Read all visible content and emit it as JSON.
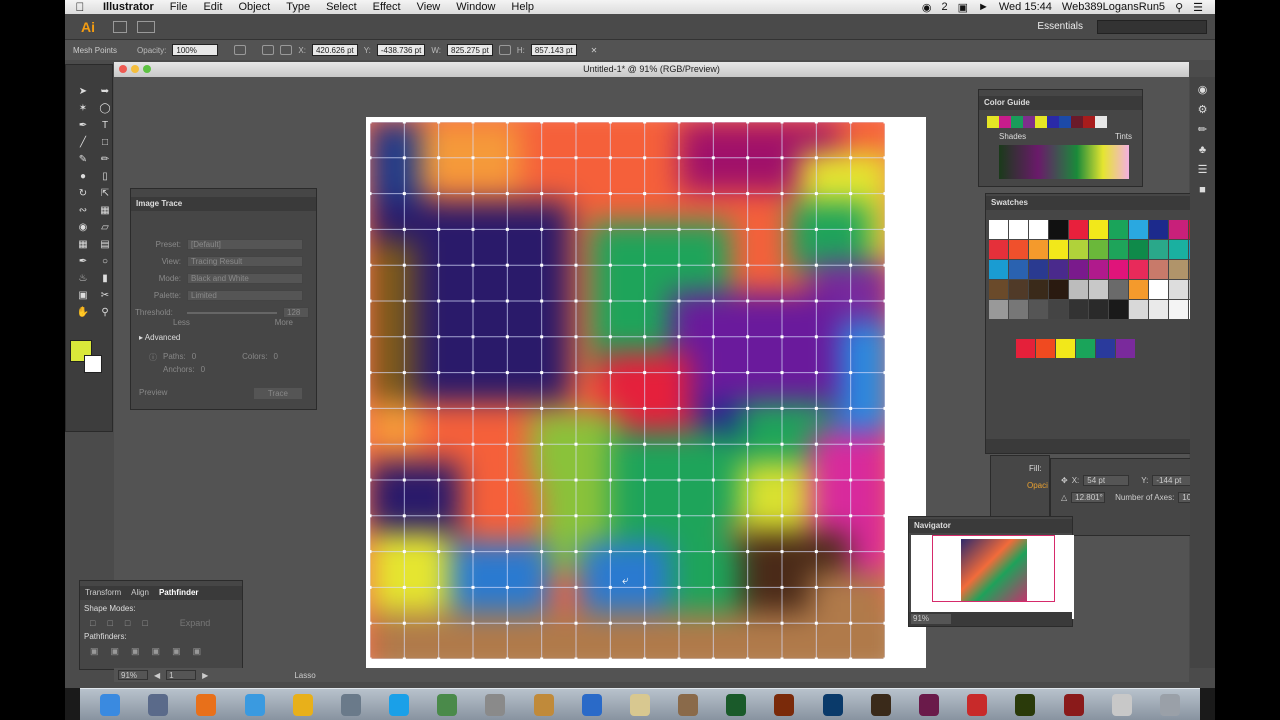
{
  "menubar": {
    "app_name": "Illustrator",
    "items": [
      "File",
      "Edit",
      "Object",
      "Type",
      "Select",
      "Effect",
      "View",
      "Window",
      "Help"
    ],
    "badge": "2",
    "clock": "Wed 15:44",
    "user": "Web389LogansRun5"
  },
  "appbar": {
    "logo": "Ai",
    "workspace": "Essentials"
  },
  "control": {
    "selection": "Mesh Points",
    "opacity_label": "Opacity:",
    "opacity": "100%",
    "x_label": "X:",
    "x": "420.626 pt",
    "y_label": "Y:",
    "y": "-438.736 pt",
    "w_label": "W:",
    "w": "825.275 pt",
    "h_label": "H:",
    "h": "857.143 pt"
  },
  "document": {
    "title": "Untitled-1* @ 91% (RGB/Preview)"
  },
  "image_trace": {
    "title": "Image Trace",
    "preset_label": "Preset:",
    "preset": "[Default]",
    "view_label": "View:",
    "view": "Tracing Result",
    "mode_label": "Mode:",
    "mode": "Black and White",
    "palette_label": "Palette:",
    "palette": "Limited",
    "threshold_label": "Threshold:",
    "threshold": "128",
    "less": "Less",
    "more": "More",
    "advanced": "Advanced",
    "paths_label": "Paths:",
    "paths": "0",
    "colors_label": "Colors:",
    "colors": "0",
    "anchors_label": "Anchors:",
    "anchors": "0",
    "preview": "Preview",
    "trace_button": "Trace"
  },
  "pathfinder": {
    "tabs": [
      "Transform",
      "Align",
      "Pathfinder"
    ],
    "shape_modes": "Shape Modes:",
    "pathfinders": "Pathfinders:",
    "expand": "Expand"
  },
  "color_guide": {
    "title": "Color Guide",
    "shades": "Shades",
    "tints": "Tints",
    "strip": [
      "#e5e525",
      "#c81c8c",
      "#1a9c5a",
      "#7e2f8c",
      "#e5e525",
      "#2a2aa8",
      "#1c4aa8",
      "#6a1a2a",
      "#a81c1c",
      "#e8e8e8"
    ]
  },
  "swatches": {
    "title": "Swatches",
    "colors": [
      "#ffffff",
      "#ffffff",
      "#ffffff",
      "#111111",
      "#e8203c",
      "#f2e81a",
      "#1aa45a",
      "#2aa8e0",
      "#1c2a8c",
      "#c8207a",
      "#c0202a",
      "#e5303a",
      "#f0502c",
      "#f49a2c",
      "#f2e81a",
      "#b0d23a",
      "#6ab83a",
      "#1ea45a",
      "#0f8a4a",
      "#2aa88a",
      "#1ab0a0",
      "#1a9cc8",
      "#1a9cd2",
      "#2a62b0",
      "#2a3a90",
      "#4a2a8c",
      "#7a1a8c",
      "#b01a8c",
      "#e0147a",
      "#e82a5a",
      "#c87a6a",
      "#b0946a",
      "#8a6a4a",
      "#6a4a2a",
      "#503a28",
      "#3a2a1a",
      "#2a1a10",
      "#bcbcbc",
      "#c8c8c8",
      "#6a6a6a",
      "#f49a2c",
      "#fff",
      "#ddd",
      "#bbb",
      "#999",
      "#777",
      "#555",
      "#444",
      "#333",
      "#2a2a2a",
      "#1a1a1a",
      "#d8d8d8",
      "#eaeaea",
      "#f4f4f4",
      "#fff"
    ],
    "group": [
      "#e5203a",
      "#f04a20",
      "#f2e81a",
      "#1aa45a",
      "#2a3a9c",
      "#7a2a9c"
    ]
  },
  "transform": {
    "x_label": "X:",
    "x": "54 pt",
    "y_label": "Y:",
    "y": "-144 pt",
    "angle": "12.801°",
    "axes_label": "Number of Axes:",
    "axes": "10",
    "fill": "Fill:",
    "opacity": "Opaci"
  },
  "navigator": {
    "title": "Navigator",
    "zoom": "91%"
  },
  "statusbar": {
    "zoom": "91%",
    "page": "1",
    "tool": "Lasso"
  },
  "dock_apps": [
    "Finder",
    "Launchpad",
    "Firefox",
    "Safari",
    "Chrome",
    "Utility",
    "Skype",
    "Preview",
    "Mail",
    "Pencil",
    "Globe",
    "Notes",
    "Pen",
    "Dreamweaver",
    "Illustrator",
    "Photoshop",
    "Bridge",
    "InDesign",
    "Acrobat",
    "Fireworks",
    "Flash",
    "Files",
    "Trash"
  ]
}
